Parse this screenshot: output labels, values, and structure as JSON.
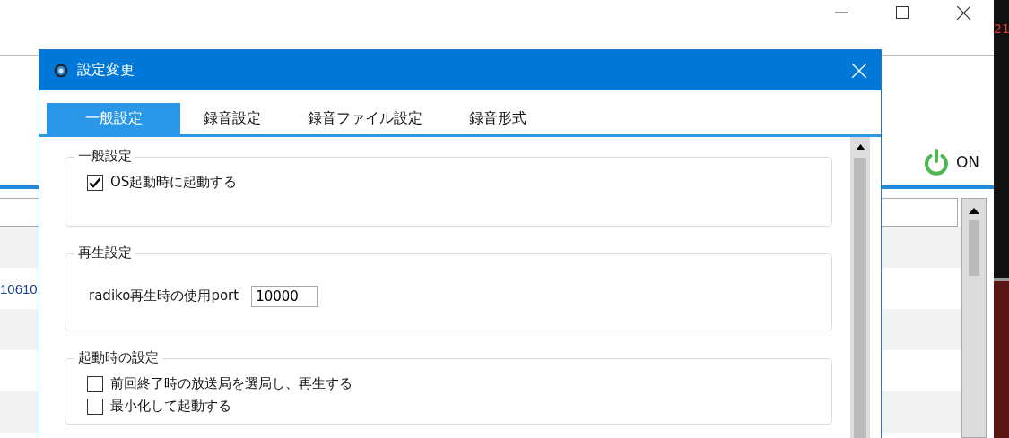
{
  "main_window": {
    "power": {
      "label": "ON",
      "on": true
    },
    "list_cell": "10610",
    "side_text": "21"
  },
  "dialog": {
    "title": "設定変更",
    "tabs": [
      {
        "label": "一般設定",
        "selected": true
      },
      {
        "label": "録音設定",
        "selected": false
      },
      {
        "label": "録音ファイル設定",
        "selected": false
      },
      {
        "label": "録音形式",
        "selected": false
      }
    ],
    "groups": [
      {
        "title": "一般設定",
        "items": [
          {
            "kind": "checkbox",
            "label": "OS起動時に起動する",
            "checked": true
          }
        ]
      },
      {
        "title": "再生設定",
        "items": [
          {
            "kind": "number",
            "label": "radiko再生時の使用port",
            "value": "10000"
          }
        ]
      },
      {
        "title": "起動時の設定",
        "items": [
          {
            "kind": "checkbox",
            "label": "前回終了時の放送局を選局し、再生する",
            "checked": false
          },
          {
            "kind": "checkbox",
            "label": "最小化して起動する",
            "checked": false
          }
        ]
      }
    ]
  }
}
